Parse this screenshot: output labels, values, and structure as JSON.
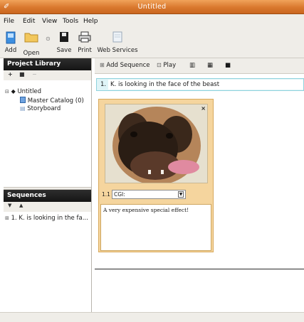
{
  "window": {
    "title": "Untitled"
  },
  "menu": [
    {
      "label": "File"
    },
    {
      "label": "Edit"
    },
    {
      "label": "View"
    },
    {
      "label": "Tools"
    },
    {
      "label": "Help"
    }
  ],
  "toolbar": {
    "add": "Add",
    "open": "Open",
    "save": "Save",
    "print": "Print",
    "web_services": "Web Services"
  },
  "project_library": {
    "title": "Project Library",
    "tree": [
      {
        "label": "Untitled"
      },
      {
        "label": "Master Catalog (0)"
      },
      {
        "label": "Storyboard"
      }
    ]
  },
  "sequences": {
    "title": "Sequences",
    "items": [
      {
        "label": "1. K. is looking in the fa..."
      }
    ]
  },
  "sequence_toolbar": {
    "add_sequence": "Add Sequence",
    "play": "Play"
  },
  "sequence": {
    "number": "1.",
    "title": "K. is looking in the face of the beast"
  },
  "clip": {
    "number": "1.1",
    "type_value": "CGI:",
    "note": "A very expensive special effect!"
  },
  "colors": {
    "titlebar": "#d9782e",
    "sequence_highlight": "#dff4f7",
    "clip_card": "#f5d59e",
    "panel_header": "#1f1f1f"
  }
}
